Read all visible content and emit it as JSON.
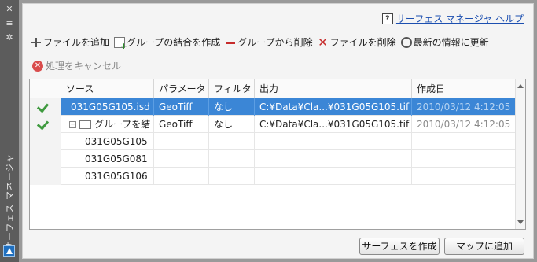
{
  "window": {
    "title": "サーフェス マネージャ"
  },
  "help": {
    "label": "サーフェス マネージャ ヘルプ"
  },
  "toolbar": {
    "add_file": "ファイルを追加",
    "combine_group": "グループの結合を作成",
    "remove_from_group": "グループから削除",
    "remove_file": "ファイルを削除",
    "refresh": "最新の情報に更新",
    "cancel_process": "処理をキャンセル"
  },
  "table": {
    "columns": [
      "ソース",
      "パラメータ",
      "フィルタ",
      "出力",
      "作成日"
    ],
    "rows": [
      {
        "source": "031G05G105.isd",
        "param": "GeoTiff",
        "filter": "なし",
        "output": "C:¥Data¥Cla...¥031G05G105.tif",
        "date": "2010/03/12 4:12:05",
        "checked": true
      },
      {
        "source": "グループを結",
        "param": "GeoTiff",
        "filter": "なし",
        "output": "C:¥Data¥Cla...¥031G05G105.tif",
        "date": "2010/03/12 4:12:05",
        "checked": true
      },
      {
        "source": "031G05G105",
        "param": "",
        "filter": "",
        "output": "",
        "date": "",
        "checked": false
      },
      {
        "source": "031G05G081",
        "param": "",
        "filter": "",
        "output": "",
        "date": "",
        "checked": false
      },
      {
        "source": "031G05G106",
        "param": "",
        "filter": "",
        "output": "",
        "date": "",
        "checked": false
      }
    ]
  },
  "buttons": {
    "create_surface": "サーフェスを作成",
    "add_to_map": "マップに追加"
  },
  "colors": {
    "selection": "#3b86d6",
    "check": "#3f9a3f",
    "link": "#1c4fb0"
  }
}
